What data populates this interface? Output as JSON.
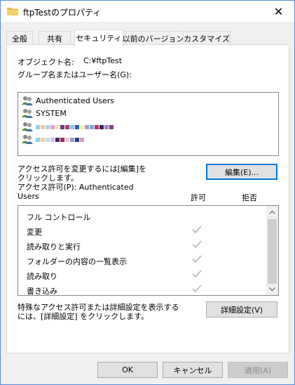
{
  "window": {
    "title": "ftpTestのプロパティ",
    "close_glyph": "✕"
  },
  "tabs": [
    {
      "label": "全般"
    },
    {
      "label": "共有"
    },
    {
      "label": "セキュリティ"
    },
    {
      "label": "以前のバージョン"
    },
    {
      "label": "カスタマイズ"
    }
  ],
  "security": {
    "object_name_label": "オブジェクト名:",
    "object_name_value": "C:¥ftpTest",
    "group_label": "グループ名またはユーザー名(G):",
    "principals": [
      {
        "name": "Authenticated Users",
        "icon": "users-group-icon"
      },
      {
        "name": "SYSTEM",
        "icon": "users-group-icon"
      },
      {
        "name": "",
        "icon": "users-group-icon"
      },
      {
        "name": "",
        "icon": "users-group-icon"
      }
    ],
    "change_hint": "アクセス許可を変更するには[編集]を クリックします。",
    "edit_button": "編集(E)...",
    "permissions_for_label": "アクセス許可(P): Authenticated Users",
    "allow_header": "許可",
    "deny_header": "拒否",
    "permissions": [
      {
        "name": "フル コントロール",
        "allow": false
      },
      {
        "name": "変更",
        "allow": true
      },
      {
        "name": "読み取りと実行",
        "allow": true
      },
      {
        "name": "フォルダーの内容の一覧表示",
        "allow": true
      },
      {
        "name": "読み取り",
        "allow": true
      },
      {
        "name": "書き込み",
        "allow": true
      }
    ],
    "advanced_hint": "特殊なアクセス許可または詳細設定を表示するには、[詳細設定] をクリックします。",
    "advanced_button": "詳細設定(V)"
  },
  "footer": {
    "ok": "OK",
    "cancel": "キャンセル",
    "apply": "適用(A)"
  },
  "colors": {
    "accent": "#0078d7",
    "check": "#b4b4b4"
  }
}
